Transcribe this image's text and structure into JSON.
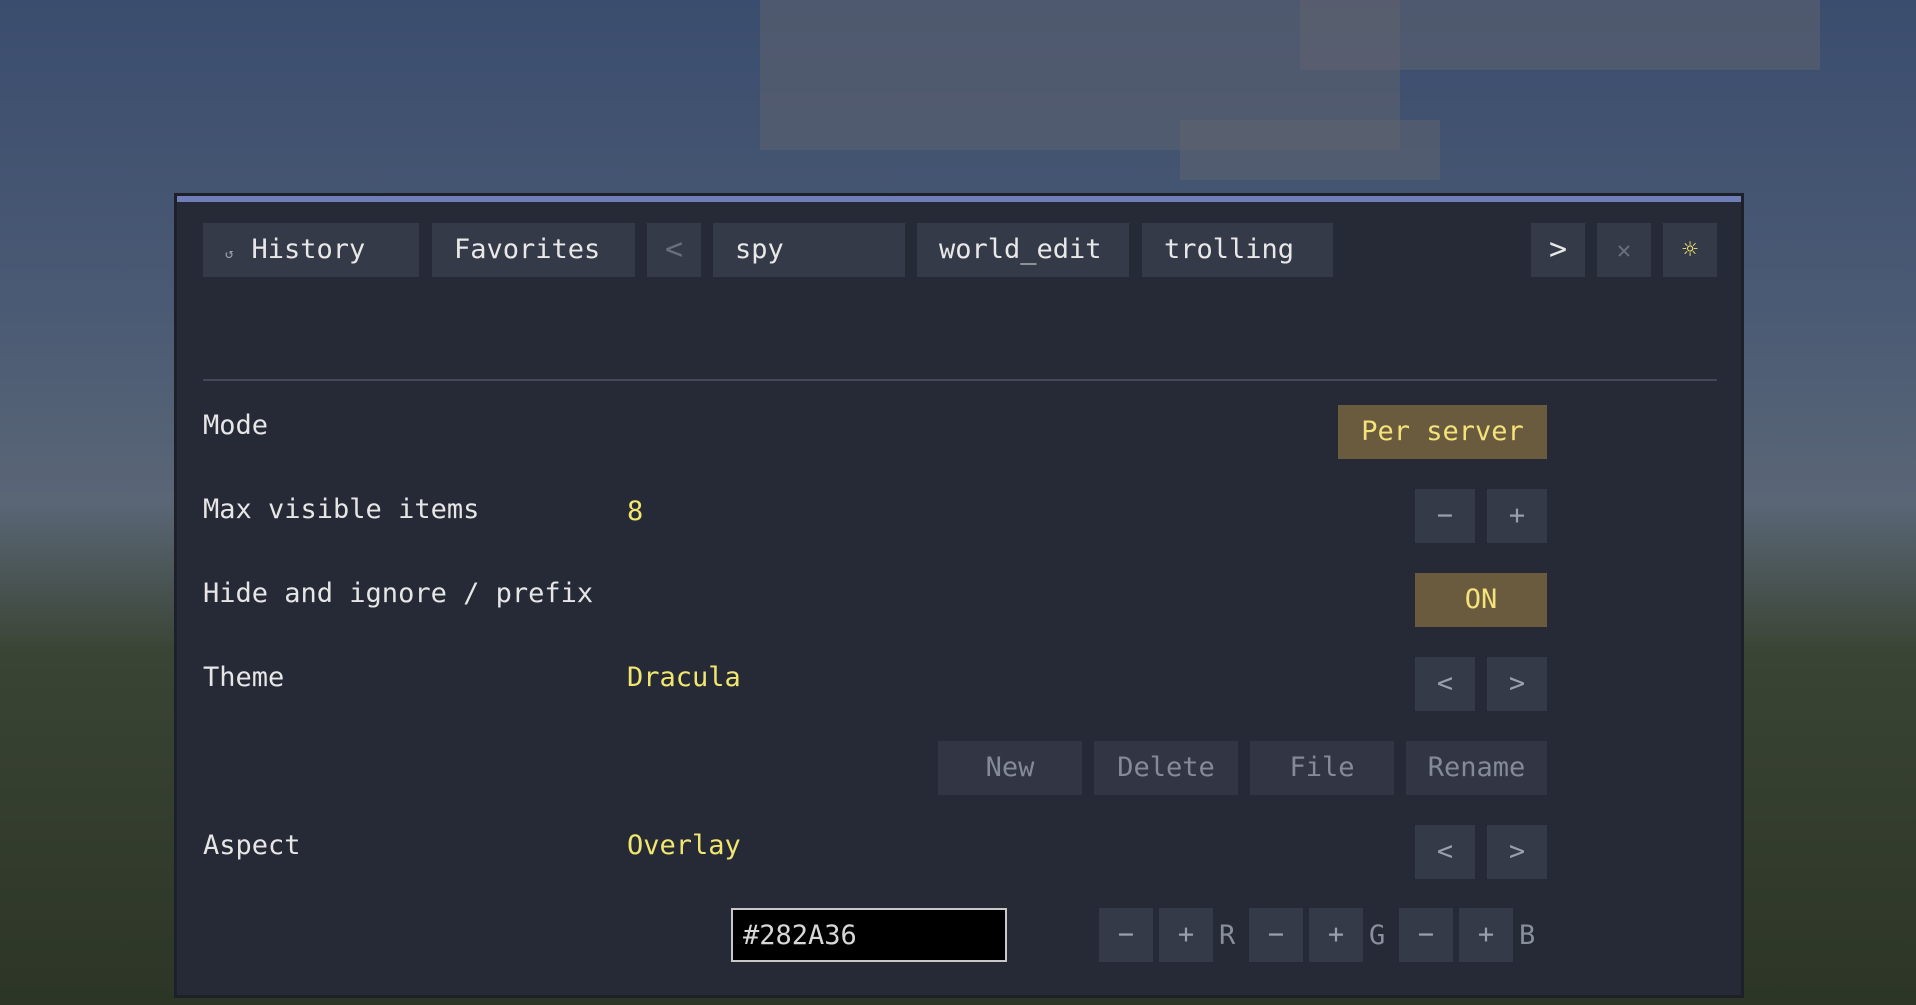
{
  "tabs": {
    "history": {
      "icon": "refresh-icon",
      "label": "History"
    },
    "favorites": {
      "label": "Favorites"
    },
    "prev": "<",
    "items": [
      "spy",
      "world_edit",
      "trolling"
    ],
    "next": ">",
    "close": "✕",
    "settings": "☼"
  },
  "settings": {
    "mode": {
      "label": "Mode",
      "value": "Per server"
    },
    "max_visible": {
      "label": "Max visible items",
      "value": "8",
      "minus": "−",
      "plus": "+"
    },
    "hide_prefix": {
      "label": "Hide and ignore / prefix",
      "value": "ON"
    },
    "theme": {
      "label": "Theme",
      "value": "Dracula",
      "prev": "<",
      "next": ">"
    },
    "theme_actions": {
      "new": "New",
      "delete": "Delete",
      "file": "File",
      "rename": "Rename"
    },
    "aspect": {
      "label": "Aspect",
      "value": "Overlay",
      "prev": "<",
      "next": ">"
    },
    "color": {
      "hex": "#282A36",
      "minus": "−",
      "plus": "+",
      "r_label": "R",
      "g_label": "G",
      "b_label": "B"
    }
  },
  "colors": {
    "panel_bg": "#262a37",
    "accent": "#6f7eb6",
    "value_yellow": "#f1e76f",
    "toggle_bg": "#6a5b3e"
  }
}
